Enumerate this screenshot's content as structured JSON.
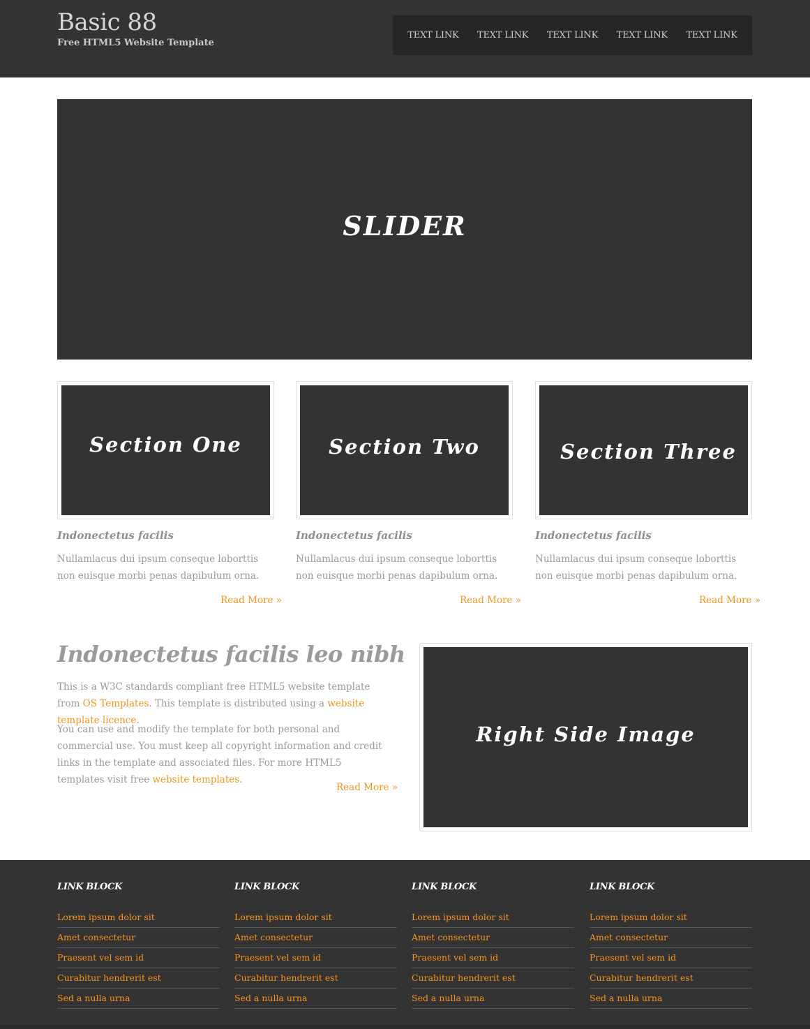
{
  "header": {
    "title": "Basic 88",
    "subtitle": "Free HTML5 Website Template",
    "nav": [
      "TEXT LINK",
      "TEXT LINK",
      "TEXT LINK",
      "TEXT LINK",
      "TEXT LINK"
    ]
  },
  "slider": {
    "label": "SLIDER"
  },
  "sections": [
    {
      "image_label": "Section One",
      "title": "Indonectetus facilis",
      "text": "Nullamlacus dui ipsum conseque loborttis non euisque morbi penas dapibulum orna.",
      "read_more": "Read More »"
    },
    {
      "image_label": "Section Two",
      "title": "Indonectetus facilis",
      "text": "Nullamlacus dui ipsum conseque loborttis non euisque morbi penas dapibulum orna.",
      "read_more": "Read More »"
    },
    {
      "image_label": "Section Three",
      "title": "Indonectetus facilis",
      "text": "Nullamlacus dui ipsum conseque loborttis non euisque morbi penas dapibulum orna.",
      "read_more": "Read More »"
    }
  ],
  "intro": {
    "heading": "Indonectetus facilis leo nibh",
    "p1_a": "This is a W3C standards compliant free HTML5 website template from ",
    "p1_link1": "OS Templates",
    "p1_b": ". This template is distributed using a ",
    "p1_link2": "website template licence",
    "p1_c": ".",
    "p2_a": "You can use and modify the template for both personal and commercial use. You must keep all copyright information and credit links in the template and associated files. For more HTML5 templates visit free ",
    "p2_link": "website templates",
    "p2_b": ".",
    "read_more": "Read More »",
    "image_label": "Right Side Image"
  },
  "footer": {
    "blocks": [
      {
        "title": "LINK BLOCK",
        "links": [
          "Lorem ipsum dolor sit",
          "Amet consectetur",
          "Praesent vel sem id",
          "Curabitur hendrerit est",
          "Sed a nulla urna"
        ]
      },
      {
        "title": "LINK BLOCK",
        "links": [
          "Lorem ipsum dolor sit",
          "Amet consectetur",
          "Praesent vel sem id",
          "Curabitur hendrerit est",
          "Sed a nulla urna"
        ]
      },
      {
        "title": "LINK BLOCK",
        "links": [
          "Lorem ipsum dolor sit",
          "Amet consectetur",
          "Praesent vel sem id",
          "Curabitur hendrerit est",
          "Sed a nulla urna"
        ]
      },
      {
        "title": "LINK BLOCK",
        "links": [
          "Lorem ipsum dolor sit",
          "Amet consectetur",
          "Praesent vel sem id",
          "Curabitur hendrerit est",
          "Sed a nulla urna"
        ]
      }
    ]
  },
  "colors": {
    "dark": "#333333",
    "accent": "#f7941d",
    "text": "#9a9a9a"
  }
}
